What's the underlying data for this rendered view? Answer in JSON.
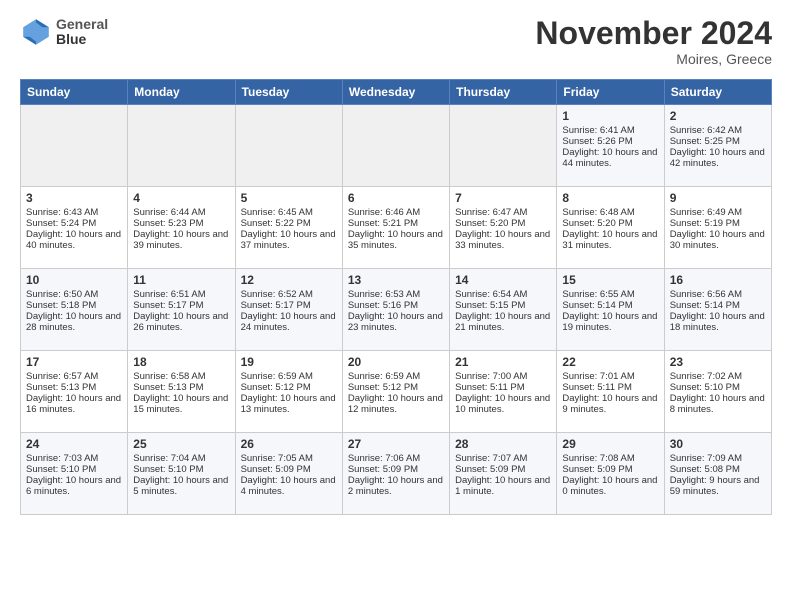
{
  "header": {
    "logo_line1": "General",
    "logo_line2": "Blue",
    "month": "November 2024",
    "location": "Moires, Greece"
  },
  "days_of_week": [
    "Sunday",
    "Monday",
    "Tuesday",
    "Wednesday",
    "Thursday",
    "Friday",
    "Saturday"
  ],
  "weeks": [
    [
      {
        "day": "",
        "sunrise": "",
        "sunset": "",
        "daylight": ""
      },
      {
        "day": "",
        "sunrise": "",
        "sunset": "",
        "daylight": ""
      },
      {
        "day": "",
        "sunrise": "",
        "sunset": "",
        "daylight": ""
      },
      {
        "day": "",
        "sunrise": "",
        "sunset": "",
        "daylight": ""
      },
      {
        "day": "",
        "sunrise": "",
        "sunset": "",
        "daylight": ""
      },
      {
        "day": "1",
        "sunrise": "Sunrise: 6:41 AM",
        "sunset": "Sunset: 5:26 PM",
        "daylight": "Daylight: 10 hours and 44 minutes."
      },
      {
        "day": "2",
        "sunrise": "Sunrise: 6:42 AM",
        "sunset": "Sunset: 5:25 PM",
        "daylight": "Daylight: 10 hours and 42 minutes."
      }
    ],
    [
      {
        "day": "3",
        "sunrise": "Sunrise: 6:43 AM",
        "sunset": "Sunset: 5:24 PM",
        "daylight": "Daylight: 10 hours and 40 minutes."
      },
      {
        "day": "4",
        "sunrise": "Sunrise: 6:44 AM",
        "sunset": "Sunset: 5:23 PM",
        "daylight": "Daylight: 10 hours and 39 minutes."
      },
      {
        "day": "5",
        "sunrise": "Sunrise: 6:45 AM",
        "sunset": "Sunset: 5:22 PM",
        "daylight": "Daylight: 10 hours and 37 minutes."
      },
      {
        "day": "6",
        "sunrise": "Sunrise: 6:46 AM",
        "sunset": "Sunset: 5:21 PM",
        "daylight": "Daylight: 10 hours and 35 minutes."
      },
      {
        "day": "7",
        "sunrise": "Sunrise: 6:47 AM",
        "sunset": "Sunset: 5:20 PM",
        "daylight": "Daylight: 10 hours and 33 minutes."
      },
      {
        "day": "8",
        "sunrise": "Sunrise: 6:48 AM",
        "sunset": "Sunset: 5:20 PM",
        "daylight": "Daylight: 10 hours and 31 minutes."
      },
      {
        "day": "9",
        "sunrise": "Sunrise: 6:49 AM",
        "sunset": "Sunset: 5:19 PM",
        "daylight": "Daylight: 10 hours and 30 minutes."
      }
    ],
    [
      {
        "day": "10",
        "sunrise": "Sunrise: 6:50 AM",
        "sunset": "Sunset: 5:18 PM",
        "daylight": "Daylight: 10 hours and 28 minutes."
      },
      {
        "day": "11",
        "sunrise": "Sunrise: 6:51 AM",
        "sunset": "Sunset: 5:17 PM",
        "daylight": "Daylight: 10 hours and 26 minutes."
      },
      {
        "day": "12",
        "sunrise": "Sunrise: 6:52 AM",
        "sunset": "Sunset: 5:17 PM",
        "daylight": "Daylight: 10 hours and 24 minutes."
      },
      {
        "day": "13",
        "sunrise": "Sunrise: 6:53 AM",
        "sunset": "Sunset: 5:16 PM",
        "daylight": "Daylight: 10 hours and 23 minutes."
      },
      {
        "day": "14",
        "sunrise": "Sunrise: 6:54 AM",
        "sunset": "Sunset: 5:15 PM",
        "daylight": "Daylight: 10 hours and 21 minutes."
      },
      {
        "day": "15",
        "sunrise": "Sunrise: 6:55 AM",
        "sunset": "Sunset: 5:14 PM",
        "daylight": "Daylight: 10 hours and 19 minutes."
      },
      {
        "day": "16",
        "sunrise": "Sunrise: 6:56 AM",
        "sunset": "Sunset: 5:14 PM",
        "daylight": "Daylight: 10 hours and 18 minutes."
      }
    ],
    [
      {
        "day": "17",
        "sunrise": "Sunrise: 6:57 AM",
        "sunset": "Sunset: 5:13 PM",
        "daylight": "Daylight: 10 hours and 16 minutes."
      },
      {
        "day": "18",
        "sunrise": "Sunrise: 6:58 AM",
        "sunset": "Sunset: 5:13 PM",
        "daylight": "Daylight: 10 hours and 15 minutes."
      },
      {
        "day": "19",
        "sunrise": "Sunrise: 6:59 AM",
        "sunset": "Sunset: 5:12 PM",
        "daylight": "Daylight: 10 hours and 13 minutes."
      },
      {
        "day": "20",
        "sunrise": "Sunrise: 6:59 AM",
        "sunset": "Sunset: 5:12 PM",
        "daylight": "Daylight: 10 hours and 12 minutes."
      },
      {
        "day": "21",
        "sunrise": "Sunrise: 7:00 AM",
        "sunset": "Sunset: 5:11 PM",
        "daylight": "Daylight: 10 hours and 10 minutes."
      },
      {
        "day": "22",
        "sunrise": "Sunrise: 7:01 AM",
        "sunset": "Sunset: 5:11 PM",
        "daylight": "Daylight: 10 hours and 9 minutes."
      },
      {
        "day": "23",
        "sunrise": "Sunrise: 7:02 AM",
        "sunset": "Sunset: 5:10 PM",
        "daylight": "Daylight: 10 hours and 8 minutes."
      }
    ],
    [
      {
        "day": "24",
        "sunrise": "Sunrise: 7:03 AM",
        "sunset": "Sunset: 5:10 PM",
        "daylight": "Daylight: 10 hours and 6 minutes."
      },
      {
        "day": "25",
        "sunrise": "Sunrise: 7:04 AM",
        "sunset": "Sunset: 5:10 PM",
        "daylight": "Daylight: 10 hours and 5 minutes."
      },
      {
        "day": "26",
        "sunrise": "Sunrise: 7:05 AM",
        "sunset": "Sunset: 5:09 PM",
        "daylight": "Daylight: 10 hours and 4 minutes."
      },
      {
        "day": "27",
        "sunrise": "Sunrise: 7:06 AM",
        "sunset": "Sunset: 5:09 PM",
        "daylight": "Daylight: 10 hours and 2 minutes."
      },
      {
        "day": "28",
        "sunrise": "Sunrise: 7:07 AM",
        "sunset": "Sunset: 5:09 PM",
        "daylight": "Daylight: 10 hours and 1 minute."
      },
      {
        "day": "29",
        "sunrise": "Sunrise: 7:08 AM",
        "sunset": "Sunset: 5:09 PM",
        "daylight": "Daylight: 10 hours and 0 minutes."
      },
      {
        "day": "30",
        "sunrise": "Sunrise: 7:09 AM",
        "sunset": "Sunset: 5:08 PM",
        "daylight": "Daylight: 9 hours and 59 minutes."
      }
    ]
  ]
}
